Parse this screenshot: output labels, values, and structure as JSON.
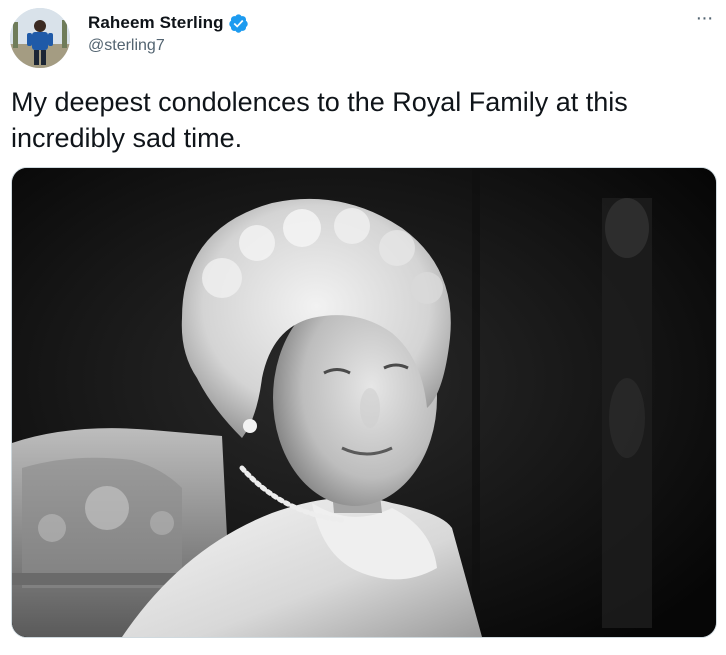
{
  "author": {
    "display_name": "Raheem Sterling",
    "handle": "@sterling7",
    "verified": true,
    "verified_color": "#1d9bf0"
  },
  "menu": {
    "more_icon": "more-horizontal-icon",
    "more_glyph": "···"
  },
  "tweet": {
    "text": "My deepest condolences to the Royal Family at this incredibly sad time."
  },
  "media": {
    "type": "photo",
    "style": "black-and-white portrait"
  },
  "colors": {
    "text_primary": "#0f1419",
    "text_secondary": "#536471",
    "border": "#cfd9de"
  }
}
